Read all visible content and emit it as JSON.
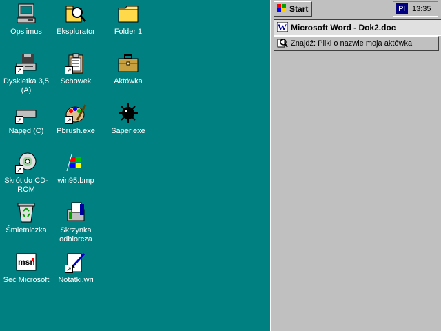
{
  "desktop": {
    "background": "#008080",
    "icons": [
      {
        "label": "Opslimus",
        "icon": "computer-icon"
      },
      {
        "label": "Eksplorator",
        "icon": "explorer-icon"
      },
      {
        "label": "Folder 1",
        "icon": "folder-icon"
      },
      {
        "label": "Dyskietka 3,5 (A)",
        "icon": "floppy-drive-icon"
      },
      {
        "label": "Schowek",
        "icon": "clipboard-icon"
      },
      {
        "label": "Aktówka",
        "icon": "briefcase-icon"
      },
      {
        "label": "Napęd (C)",
        "icon": "hard-drive-icon"
      },
      {
        "label": "Pbrush.exe",
        "icon": "paintbrush-icon"
      },
      {
        "label": "Saper.exe",
        "icon": "minesweeper-icon"
      },
      {
        "label": "Skrót do CD-ROM",
        "icon": "cdrom-icon"
      },
      {
        "label": "win95.bmp",
        "icon": "bitmap-icon"
      },
      {
        "label": "Śmietniczka",
        "icon": "recycle-bin-icon"
      },
      {
        "label": "Skrzynka odbiorcza",
        "icon": "inbox-icon"
      },
      {
        "label": "Seć Microsoft",
        "icon": "msn-icon"
      },
      {
        "label": "Notatki.wri",
        "icon": "write-document-icon"
      }
    ]
  },
  "taskbar": {
    "start_label": "Start",
    "lang": "Pl",
    "clock": "13:35",
    "tasks": [
      {
        "label": "Microsoft Word - Dok2.doc",
        "icon": "word-icon",
        "active": true
      },
      {
        "label": "Znajdź: Pliki o nazwie moja aktówka",
        "icon": "find-icon",
        "active": false
      }
    ]
  }
}
